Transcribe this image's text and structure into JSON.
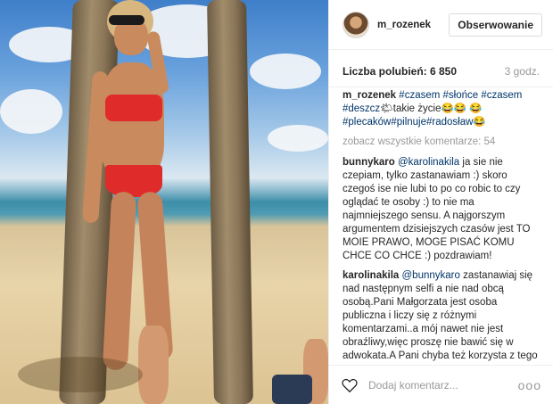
{
  "post": {
    "username": "m_rozenek",
    "follow_label": "Obserwowanie",
    "likes_label": "Liczba polubień: 6 850",
    "time_ago": "3 godz.",
    "caption_author": "m_rozenek",
    "caption_parts": {
      "t1": "#czasem",
      "t2": "#słońce",
      "t3": "#czasem",
      "t4": "#deszcz",
      "mid": "🌤takie życie😂😂",
      "t5": "😂#plecaków",
      "t6": "#pilnuje",
      "t7": "#radosław",
      "end": "😂"
    },
    "view_all_comments": "zobacz wszystkie komentarze: 54",
    "comments": [
      {
        "author": "bunnykaro",
        "mention": "@karolinakila",
        "text": " ja sie nie czepiam, tylko zastanawiam :) skoro czegoś ise nie lubi to po co robic to czy oglądać te osoby :) to nie ma najmniejszego sensu. A najgorszym argumentem dzisiejszych czasów jest TO MOIE PRAWO, MOGE PISAĆ KOMU CHCE CO CHCE :) pozdrawiam!"
      },
      {
        "author": "karolinakila",
        "mention": "@bunnykaro",
        "text": " zastanawiaj się nad następnym selfi a nie nad obcą osobą.Pani Małgorzata jest osoba publiczna i liczy się z różnymi komentarzami..a mój nawet nie jest obraźliwy,więc proszę nie bawić się w adwokata.A Pani chyba też korzysta z tego najgorszego prawa bo inaczej skąd komentarz do mnie"
      }
    ],
    "add_comment_placeholder": "Dodaj komentarz...",
    "more_label": "ooo"
  },
  "icons": {
    "heart": "heart-icon",
    "more": "more-options-icon"
  }
}
